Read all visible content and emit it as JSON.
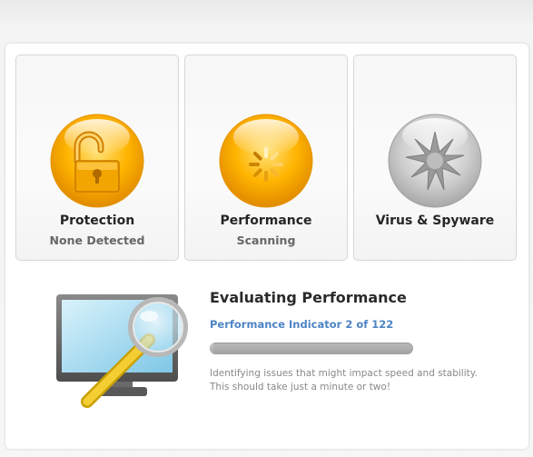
{
  "window": {
    "title": "",
    "colors": {
      "accent_blue": "#4d84c4",
      "orb_gold": "#f5a800",
      "orb_grey": "#bdbdbd",
      "text_dark": "#262626",
      "text_muted": "#666666"
    }
  },
  "cards": [
    {
      "title": "Protection",
      "status": "None Detected",
      "icon": "padlock-icon",
      "state": "active"
    },
    {
      "title": "Performance",
      "status": "Scanning",
      "icon": "spinner-icon",
      "state": "active"
    },
    {
      "title": "Virus & Spyware",
      "status": "",
      "icon": "virus-icon",
      "state": "inactive"
    }
  ],
  "evaluation": {
    "heading": "Evaluating Performance",
    "indicator": "Performance Indicator 2 of 122",
    "indicator_current": 2,
    "indicator_total": 122,
    "progress_fraction": 0.02,
    "description_line1": "Identifying issues that might impact speed and stability.",
    "description_line2": "This should take just a minute or two!",
    "illustration": "monitor-magnifier-icon"
  }
}
